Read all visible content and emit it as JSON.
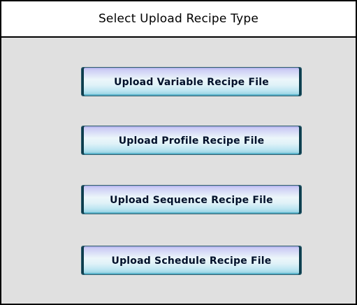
{
  "dialog": {
    "title": "Select Upload Recipe Type",
    "buttons": [
      {
        "label": "Upload Variable Recipe File"
      },
      {
        "label": "Upload Profile Recipe File"
      },
      {
        "label": "Upload Sequence Recipe File"
      },
      {
        "label": "Upload Schedule Recipe File"
      }
    ]
  },
  "colors": {
    "panel_background": "#e0e0e0",
    "title_background": "#ffffff",
    "border": "#000000",
    "button_edge": "#0d3d4d",
    "button_text": "#00102a"
  }
}
